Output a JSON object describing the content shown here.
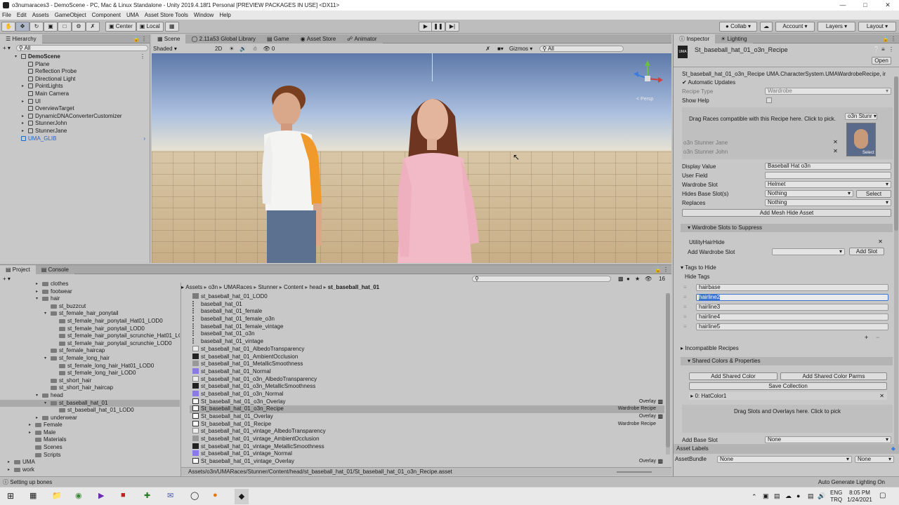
{
  "window": {
    "title": "o3numaraces3 - DemoScene - PC, Mac & Linux Standalone - Unity 2019.4.18f1 Personal [PREVIEW PACKAGES IN USE] <DX11>"
  },
  "menu": [
    "File",
    "Edit",
    "Assets",
    "GameObject",
    "Component",
    "UMA",
    "Asset Store Tools",
    "Window",
    "Help"
  ],
  "toolbar": {
    "center": "Center",
    "local": "Local",
    "collab": "Collab",
    "account": "Account",
    "layers": "Layers",
    "layout": "Layout"
  },
  "hierarchy": {
    "tab": "Hierarchy",
    "search_placeholder": "All",
    "items": [
      {
        "label": "DemoScene",
        "depth": 0
      },
      {
        "label": "Plane",
        "depth": 1
      },
      {
        "label": "Reflection Probe",
        "depth": 1
      },
      {
        "label": "Directional Light",
        "depth": 1
      },
      {
        "label": "PointLights",
        "depth": 1
      },
      {
        "label": "Main Camera",
        "depth": 1
      },
      {
        "label": "UI",
        "depth": 1
      },
      {
        "label": "OverviewTarget",
        "depth": 1
      },
      {
        "label": "DynamicDNAConverterCustomizer",
        "depth": 1
      },
      {
        "label": "StunnerJohn",
        "depth": 1
      },
      {
        "label": "StunnerJane",
        "depth": 1
      },
      {
        "label": "UMA_GLIB",
        "depth": 0
      }
    ]
  },
  "scene": {
    "tabs": [
      "Scene",
      "2.11a53 Global Library",
      "Game",
      "Asset Store",
      "Animator"
    ],
    "shading": "Shaded",
    "mode2d": "2D",
    "gizmos": "Gizmos",
    "search_placeholder": "All",
    "persp": "< Persp"
  },
  "project": {
    "tabs": [
      "Project",
      "Console"
    ],
    "count": "16",
    "breadcrumb": [
      "Assets",
      "o3n",
      "UMARaces",
      "Stunner",
      "Content",
      "head",
      "st_baseball_hat_01"
    ],
    "folders": [
      {
        "label": "clothes",
        "depth": 0
      },
      {
        "label": "footwear",
        "depth": 0
      },
      {
        "label": "hair",
        "depth": 0
      },
      {
        "label": "st_buzzcut",
        "depth": 1
      },
      {
        "label": "st_female_hair_ponytail",
        "depth": 1
      },
      {
        "label": "st_female_hair_ponytail_Hat01_LOD0",
        "depth": 2
      },
      {
        "label": "st_female_hair_ponytail_LOD0",
        "depth": 2
      },
      {
        "label": "st_female_hair_ponytail_scrunchie_Hat01_LO",
        "depth": 2
      },
      {
        "label": "st_female_hair_ponytail_scrunchie_LOD0",
        "depth": 2
      },
      {
        "label": "st_female_haircap",
        "depth": 1
      },
      {
        "label": "st_female_long_hair",
        "depth": 1
      },
      {
        "label": "st_female_long_hair_Hat01_LOD0",
        "depth": 2
      },
      {
        "label": "st_female_long_hair_LOD0",
        "depth": 2
      },
      {
        "label": "st_short_hair",
        "depth": 1
      },
      {
        "label": "st_short_hair_haircap",
        "depth": 1
      },
      {
        "label": "head",
        "depth": 0
      },
      {
        "label": "st_baseball_hat_01",
        "depth": 1
      },
      {
        "label": "st_baseball_hat_01_LOD0",
        "depth": 2
      },
      {
        "label": "underwear",
        "depth": 0
      },
      {
        "label": "Female",
        "depth": -1
      },
      {
        "label": "Male",
        "depth": -1
      },
      {
        "label": "Materials",
        "depth": -1
      },
      {
        "label": "Scenes",
        "depth": -1
      },
      {
        "label": "Scripts",
        "depth": -1
      },
      {
        "label": "UMA",
        "depth": -2
      },
      {
        "label": "work",
        "depth": -2
      }
    ],
    "assets": [
      {
        "name": "st_baseball_hat_01_LOD0",
        "type": "",
        "icon": "folder"
      },
      {
        "name": "baseball_hat_01",
        "type": "",
        "icon": "mesh"
      },
      {
        "name": "baseball_hat_01_female",
        "type": "",
        "icon": "mesh"
      },
      {
        "name": "baseball_hat_01_female_o3n",
        "type": "",
        "icon": "mesh"
      },
      {
        "name": "baseball_hat_01_female_vintage",
        "type": "",
        "icon": "mesh"
      },
      {
        "name": "baseball_hat_01_o3n",
        "type": "",
        "icon": "mesh"
      },
      {
        "name": "baseball_hat_01_vintage",
        "type": "",
        "icon": "mesh"
      },
      {
        "name": "st_baseball_hat_01_AlbedoTransparency",
        "type": "",
        "icon": "tex-light"
      },
      {
        "name": "st_baseball_hat_01_AmbientOcclusion",
        "type": "",
        "icon": "tex-dark"
      },
      {
        "name": "st_baseball_hat_01_MetallicSmoothness",
        "type": "",
        "icon": "tex-gray"
      },
      {
        "name": "st_baseball_hat_01_Normal",
        "type": "",
        "icon": "tex-normal"
      },
      {
        "name": "st_baseball_hat_01_o3n_AlbedoTransparency",
        "type": "",
        "icon": "tex-light"
      },
      {
        "name": "st_baseball_hat_01_o3n_MetallicSmoothness",
        "type": "",
        "icon": "tex-dark"
      },
      {
        "name": "st_baseball_hat_01_o3n_Normal",
        "type": "",
        "icon": "tex-normal"
      },
      {
        "name": "St_baseball_hat_01_o3n_Overlay",
        "type": "Overlay",
        "icon": "asset"
      },
      {
        "name": "St_baseball_hat_01_o3n_Recipe",
        "type": "Wardrobe Recipe",
        "icon": "asset"
      },
      {
        "name": "St_baseball_hat_01_Overlay",
        "type": "Overlay",
        "icon": "asset"
      },
      {
        "name": "St_baseball_hat_01_Recipe",
        "type": "Wardrobe Recipe",
        "icon": "asset"
      },
      {
        "name": "st_baseball_hat_01_vintage_AlbedoTransparency",
        "type": "",
        "icon": "tex-light"
      },
      {
        "name": "st_baseball_hat_01_vintage_AmbientOcclusion",
        "type": "",
        "icon": "tex-gray"
      },
      {
        "name": "st_baseball_hat_01_vintage_MetallicSmoothness",
        "type": "",
        "icon": "tex-dark"
      },
      {
        "name": "st_baseball_hat_01_vintage_Normal",
        "type": "",
        "icon": "tex-normal"
      },
      {
        "name": "St_baseball_hat_01_vintage_Overlay",
        "type": "Overlay",
        "icon": "asset"
      }
    ],
    "path": "Assets/o3n/UMARaces/Stunner/Content/head/st_baseball_hat_01/St_baseball_hat_01_o3n_Recipe.asset"
  },
  "inspector": {
    "tabs": [
      "Inspector",
      "Lighting"
    ],
    "object_name": "St_baseball_hat_01_o3n_Recipe",
    "open": "Open",
    "type_line": "St_baseball_hat_01_o3n_Recipe UMA.CharacterSystem.UMAWardrobeRecipe, ir",
    "auto_updates": "Automatic Updates",
    "recipe_type_label": "Recipe Type",
    "recipe_type": "Wardrobe",
    "show_help": "Show Help",
    "drag_races": "Drag Races compatible with this Recipe here. Click to pick.",
    "race_dropdown": "o3n Stunr",
    "races": [
      "o3n Stunner Jane",
      "o3n Stunner John"
    ],
    "select": "Select",
    "display_value_label": "Display Value",
    "display_value": "Baseball Hat o3n",
    "user_field_label": "User Field",
    "wardrobe_slot_label": "Wardrobe Slot",
    "wardrobe_slot": "Helmet",
    "hides_base_label": "Hides Base Slot(s)",
    "hides_base": "Nothing",
    "replaces_label": "Replaces",
    "replaces": "Nothing",
    "add_mesh_hide": "Add Mesh Hide Asset",
    "suppress_header": "Wardrobe Slots to Suppress",
    "suppress_item": "UtilityHairHide",
    "add_wardrobe_slot": "Add Wardrobe Slot",
    "add_slot": "Add Slot",
    "tags_header": "Tags to Hide",
    "hide_tags_label": "Hide Tags",
    "tags": [
      "hairbase",
      "hairline2",
      "hairline3",
      "hairline4",
      "hairline5"
    ],
    "incompatible": "Incompatible Recipes",
    "shared_colors": "Shared Colors & Properties",
    "add_shared_color": "Add Shared Color",
    "add_shared_params": "Add Shared Color Parms",
    "save_collection": "Save Collection",
    "hat_color": "0: HatColor1",
    "drag_slots": "Drag Slots and Overlays here. Click to pick",
    "add_base_slot_label": "Add Base Slot",
    "add_base_slot": "None",
    "asset_labels": "Asset Labels",
    "asset_bundle_label": "AssetBundle",
    "asset_bundle": "None",
    "asset_variant": "None"
  },
  "status": {
    "left": "Setting up bones",
    "right": "Auto Generate Lighting On"
  },
  "taskbar": {
    "lang": "ENG",
    "region": "TRQ",
    "time": "8:05 PM",
    "date": "1/24/2021"
  },
  "colors": {
    "accent": "#3d7de0",
    "selection": "#3b73d2",
    "panel": "#c2c2c2"
  }
}
